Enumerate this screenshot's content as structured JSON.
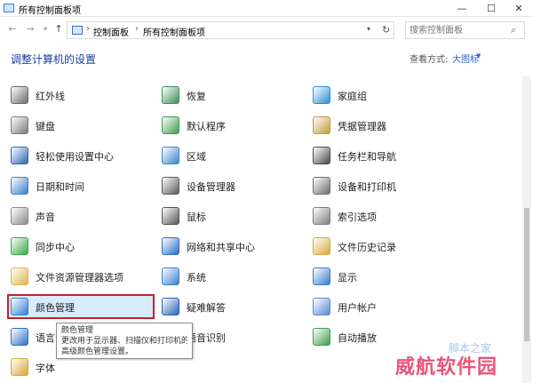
{
  "window": {
    "title": "所有控制面板项",
    "min": "—",
    "max": "☐",
    "close": "✕"
  },
  "nav": {
    "back": "←",
    "forward": "→",
    "dropdown": "▾",
    "up": "↑"
  },
  "address": {
    "crumbs": [
      "控制面板",
      "所有控制面板项"
    ],
    "separator": "›",
    "dropdown": "▾",
    "refresh": "↻"
  },
  "search": {
    "placeholder": "搜索控制面板",
    "icon": "⌕"
  },
  "header": {
    "title": "调整计算机的设置",
    "view_by_label": "查看方式:",
    "view_by_value": "大图标",
    "view_by_drop": "▼"
  },
  "items": [
    {
      "label": "红外线",
      "icon": "infrared-icon",
      "color": "#6b6b6b"
    },
    {
      "label": "恢复",
      "icon": "recovery-icon",
      "color": "#3a8f5a"
    },
    {
      "label": "家庭组",
      "icon": "homegroup-icon",
      "color": "#2c8fd6"
    },
    {
      "label": "键盘",
      "icon": "keyboard-icon",
      "color": "#7a7a7a"
    },
    {
      "label": "默认程序",
      "icon": "default-programs-icon",
      "color": "#3f9b4a"
    },
    {
      "label": "凭据管理器",
      "icon": "credential-manager-icon",
      "color": "#c59a3a"
    },
    {
      "label": "轻松使用设置中心",
      "icon": "ease-of-access-icon",
      "color": "#2e64b8"
    },
    {
      "label": "区域",
      "icon": "region-icon",
      "color": "#3a86c9"
    },
    {
      "label": "任务栏和导航",
      "icon": "taskbar-icon",
      "color": "#4a4a4a"
    },
    {
      "label": "日期和时间",
      "icon": "date-time-icon",
      "color": "#3d7cc9"
    },
    {
      "label": "设备管理器",
      "icon": "device-manager-icon",
      "color": "#5a5a5a"
    },
    {
      "label": "设备和打印机",
      "icon": "devices-printers-icon",
      "color": "#6d6d6d"
    },
    {
      "label": "声音",
      "icon": "sound-icon",
      "color": "#8a8a8a"
    },
    {
      "label": "鼠标",
      "icon": "mouse-icon",
      "color": "#555555"
    },
    {
      "label": "索引选项",
      "icon": "indexing-icon",
      "color": "#7d7d7d"
    },
    {
      "label": "同步中心",
      "icon": "sync-center-icon",
      "color": "#3aa844"
    },
    {
      "label": "网络和共享中心",
      "icon": "network-sharing-icon",
      "color": "#2c6fbf"
    },
    {
      "label": "文件历史记录",
      "icon": "file-history-icon",
      "color": "#d8a93a"
    },
    {
      "label": "文件资源管理器选项",
      "icon": "file-explorer-options-icon",
      "color": "#e0b64a"
    },
    {
      "label": "系统",
      "icon": "system-icon",
      "color": "#3b7fd0"
    },
    {
      "label": "显示",
      "icon": "display-icon",
      "color": "#3a7cc8"
    },
    {
      "label": "颜色管理",
      "icon": "color-management-icon",
      "color": "#2f7fd8"
    },
    {
      "label": "疑难解答",
      "icon": "troubleshooting-icon",
      "color": "#2a66b6"
    },
    {
      "label": "用户帐户",
      "icon": "user-accounts-icon",
      "color": "#5a8ad0"
    },
    {
      "label": "语言",
      "icon": "language-icon",
      "color": "#2e73c4"
    },
    {
      "label": "语音识别",
      "icon": "speech-recognition-icon",
      "color": "#777777"
    },
    {
      "label": "自动播放",
      "icon": "autoplay-icon",
      "color": "#3aa04a"
    },
    {
      "label": "字体",
      "icon": "fonts-icon",
      "color": "#d7a533"
    }
  ],
  "tooltip": {
    "line1": "颜色管理",
    "line2": "更改用于显示器、扫描仪和打印机的",
    "line3": "高级颜色管理设置。"
  },
  "watermark": {
    "text": "威航软件园",
    "sub": "脚本之家"
  },
  "colors": {
    "selection_border": "#c8202a",
    "selection_fill": "#d9ecfb",
    "link": "#2b63c9",
    "title": "#1a3e9e"
  }
}
